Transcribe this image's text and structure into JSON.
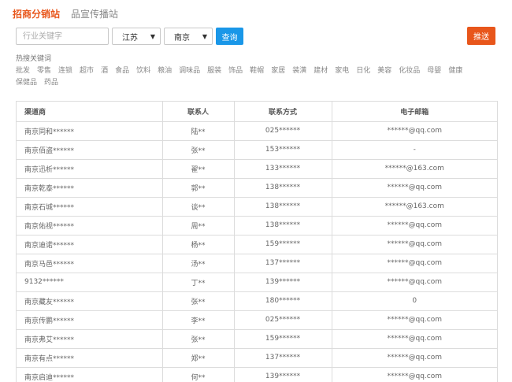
{
  "tabs": [
    {
      "label": "招商分销站",
      "active": true
    },
    {
      "label": "品宣传播站",
      "active": false
    }
  ],
  "search": {
    "placeholder": "行业关键字",
    "value": ""
  },
  "filters": {
    "province": "江苏",
    "city": "南京"
  },
  "buttons": {
    "query_label": "查询",
    "push_label": "推送"
  },
  "hot_keywords": {
    "title": "热搜关键词",
    "items": [
      "批发",
      "零售",
      "连锁",
      "超市",
      "酒",
      "食品",
      "饮料",
      "粮油",
      "调味品",
      "服装",
      "饰品",
      "鞋帽",
      "家居",
      "装潢",
      "建材",
      "家电",
      "日化",
      "美容",
      "化妆品",
      "母婴",
      "健康",
      "保健品",
      "药品"
    ]
  },
  "table": {
    "headers": [
      "渠道商",
      "联系人",
      "联系方式",
      "电子邮箱"
    ],
    "rows": [
      [
        "南京同和******",
        "陆**",
        "025******",
        "******@qq.com"
      ],
      [
        "南京佰盗******",
        "张**",
        "153******",
        "-"
      ],
      [
        "南京迅析******",
        "翟**",
        "133******",
        "******@163.com"
      ],
      [
        "南京乾泰******",
        "郭**",
        "138******",
        "******@qq.com"
      ],
      [
        "南京石城******",
        "谈**",
        "138******",
        "******@163.com"
      ],
      [
        "南京佑视******",
        "周**",
        "138******",
        "******@qq.com"
      ],
      [
        "南京迪诺******",
        "杨**",
        "159******",
        "******@qq.com"
      ],
      [
        "南京马邑******",
        "汤**",
        "137******",
        "******@qq.com"
      ],
      [
        "9132******",
        "丁**",
        "139******",
        "******@qq.com"
      ],
      [
        "南京藏友******",
        "张**",
        "180******",
        "0"
      ],
      [
        "南京传鹏******",
        "李**",
        "025******",
        "******@qq.com"
      ],
      [
        "南京弗艾******",
        "张**",
        "159******",
        "******@qq.com"
      ],
      [
        "南京有点******",
        "郑**",
        "137******",
        "******@qq.com"
      ],
      [
        "南京启迪******",
        "何**",
        "139******",
        "******@qq.com"
      ]
    ]
  },
  "colors": {
    "accent_orange": "#e8561b",
    "accent_blue": "#1a97e8"
  }
}
